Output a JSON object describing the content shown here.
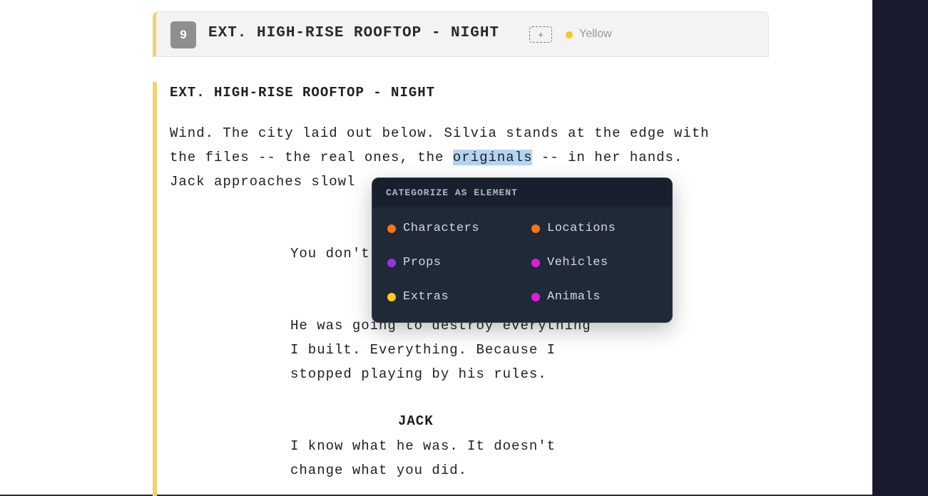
{
  "scene_header": {
    "number": "9",
    "title": "EXT. HIGH-RISE ROOFTOP - NIGHT",
    "add_tag_label": "+",
    "color_label": "Yellow",
    "color": "#f2cc1c"
  },
  "script": {
    "slugline": "EXT. HIGH-RISE ROOFTOP - NIGHT",
    "action_line1": "Wind. The city laid out below. Silvia stands at the edge with",
    "action_line2_before": "the files -- the real ones, the ",
    "action_line2_selected": "originals",
    "action_line2_after": " -- in her hands.",
    "action_line3": "Jack approaches slowl",
    "dialogue1_line1": "You don't",
    "dialogue2_line1": "He was going to destroy everything",
    "dialogue2_line2": "I built. Everything. Because I",
    "dialogue2_line3": "stopped playing by his rules.",
    "character": "JACK",
    "dialogue3_line1": "I know what he was. It doesn't",
    "dialogue3_line2": "change what you did."
  },
  "popup": {
    "title": "CATEGORIZE AS ELEMENT",
    "options": [
      {
        "label": "Characters",
        "color": "#f97316"
      },
      {
        "label": "Locations",
        "color": "#f97316"
      },
      {
        "label": "Props",
        "color": "#9333ea"
      },
      {
        "label": "Vehicles",
        "color": "#e11dd8"
      },
      {
        "label": "Extras",
        "color": "#facc15"
      },
      {
        "label": "Animals",
        "color": "#e11dd8"
      }
    ]
  },
  "colors": {
    "scene_accent": "#f0d36e",
    "selection": "#b4d4f4",
    "popup_bg": "#1f2937",
    "right_panel": "#1a1a2e"
  }
}
